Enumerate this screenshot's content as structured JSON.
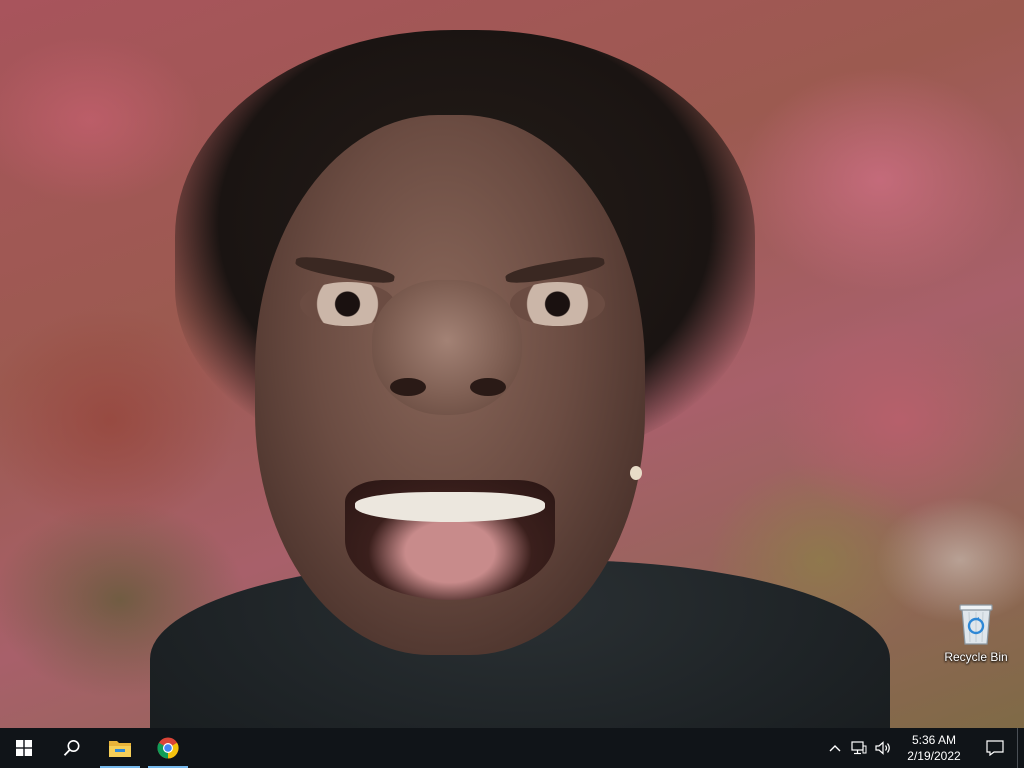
{
  "desktop": {
    "icons": [
      {
        "label": "Recycle Bin",
        "icon": "recycle-bin-icon"
      }
    ]
  },
  "taskbar": {
    "start_icon": "windows-start-icon",
    "search_icon": "search-icon",
    "pinned": [
      {
        "name": "File Explorer",
        "icon": "file-explorer-icon",
        "running": true
      },
      {
        "name": "Google Chrome",
        "icon": "chrome-icon",
        "running": true
      }
    ],
    "tray": {
      "overflow_icon": "chevron-up-icon",
      "network_icon": "network-icon",
      "volume_icon": "volume-icon",
      "time": "5:36 AM",
      "date": "2/19/2022",
      "notification_icon": "action-center-icon"
    },
    "accent": "#76b9ed",
    "background": "#101418"
  }
}
